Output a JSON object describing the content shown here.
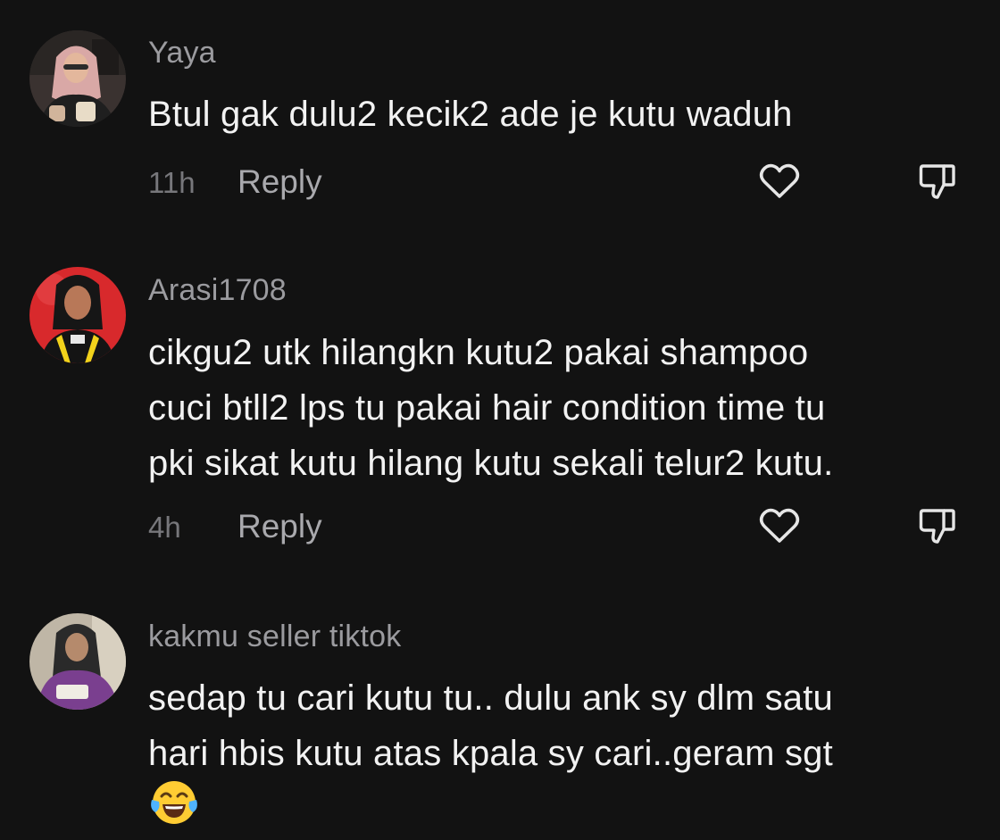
{
  "comments": [
    {
      "username": "Yaya",
      "lines": [
        "Btul gak dulu2 kecik2 ade je kutu waduh"
      ],
      "time": "11h",
      "reply_label": "Reply"
    },
    {
      "username": "Arasi1708",
      "lines": [
        "cikgu2 utk hilangkn kutu2 pakai shampoo",
        "cuci btll2 lps tu pakai hair condition time tu",
        "pki sikat kutu hilang kutu sekali telur2 kutu."
      ],
      "time": "4h",
      "reply_label": "Reply"
    },
    {
      "username": "kakmu seller tiktok",
      "lines": [
        "sedap tu cari kutu tu.. dulu ank sy dlm satu",
        "hari hbis kutu atas kpala sy cari..geram sgt"
      ],
      "emoji": "face-with-tears-of-joy"
    }
  ],
  "icons": {
    "like": "heart-outline-icon",
    "dislike": "thumbs-down-outline-icon"
  },
  "colors": {
    "background": "#121212",
    "username": "#9b9b9f",
    "text": "#f2f2f2",
    "time": "#77777b",
    "reply": "#a9a9ad",
    "icon": "#e6e6e6"
  }
}
